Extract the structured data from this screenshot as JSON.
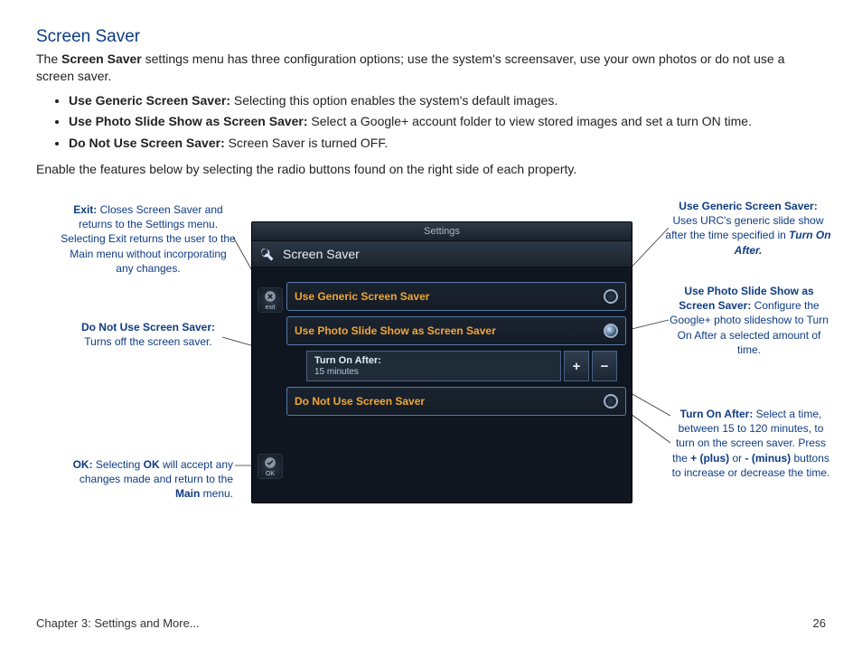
{
  "title": "Screen Saver",
  "intro": {
    "pre": "The ",
    "bold": "Screen Saver",
    "post": " settings menu has three configuration options; use the system's screensaver, use your own photos or do not use a screen saver."
  },
  "options": [
    {
      "bold": "Use Generic Screen Saver:",
      "rest": " Selecting this option enables the system's default images."
    },
    {
      "bold": "Use Photo Slide Show as Screen Saver:",
      "rest": " Select a Google+ account folder to view stored images and set a turn ON time."
    },
    {
      "bold": "Do Not Use Screen Saver:",
      "rest": " Screen Saver is turned OFF."
    }
  ],
  "enable_text": "Enable the features below by selecting the radio buttons found on the right side of each property.",
  "device": {
    "top": "Settings",
    "header": "Screen Saver",
    "exit_label": "exit",
    "ok_label": "OK",
    "rows": {
      "generic": "Use Generic Screen Saver",
      "photo": "Use Photo Slide Show as Screen Saver",
      "donot": "Do Not Use Screen Saver"
    },
    "turn_on": {
      "label": "Turn On After:",
      "value": "15 minutes"
    },
    "plus": "+",
    "minus": "−"
  },
  "callouts": {
    "exit": {
      "b": "Exit:",
      "t": " Closes Screen Saver and returns to the Settings menu. Selecting Exit returns the user to the Main menu without incorporating any changes."
    },
    "donot": {
      "b": "Do Not Use Screen Saver:",
      "t": " Turns off the screen saver."
    },
    "ok": {
      "b1": "OK:",
      "t1": " Selecting ",
      "b2": "OK",
      "t2": " will accept any changes made and return to the ",
      "b3": "Main",
      "t3": " menu."
    },
    "generic": {
      "b": "Use Generic Screen Saver:",
      "t": " Uses URC's generic slide show after the time specified in ",
      "i": "Turn On After."
    },
    "photo": {
      "b": "Use Photo Slide Show as Screen Saver:",
      "t": " Configure the Google+ photo slideshow to Turn On After a selected amount of time."
    },
    "turnon": {
      "b1": "Turn On After:",
      "t1": " Select a time, between 15 to 120 minutes, to turn on the screen saver. Press the ",
      "b2": "+ (plus)",
      "t2": " or ",
      "b3": "- (minus)",
      "t3": " buttons to increase or decrease the time."
    }
  },
  "footer": {
    "chapter": "Chapter 3: Settings and More...",
    "page": "26"
  }
}
